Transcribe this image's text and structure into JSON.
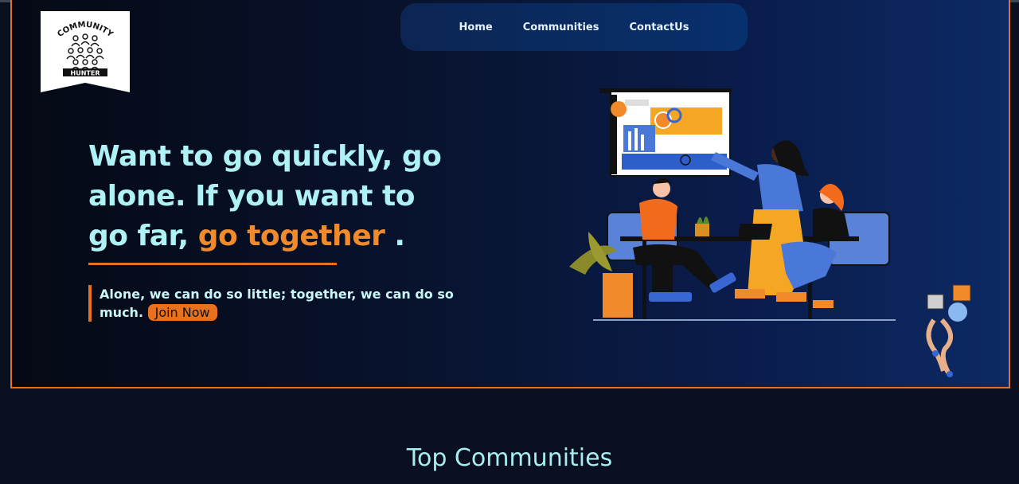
{
  "brand": {
    "logo_top": "COMMUNITY",
    "logo_bottom": "HUNTER"
  },
  "nav": {
    "items": [
      "Home",
      "Communities",
      "ContactUs"
    ]
  },
  "hero": {
    "headline_part1": "Want to go quickly, go alone. If you want to go far,",
    "headline_accent": "go together",
    "headline_end": ".",
    "quote": "Alone, we can do so little; together, we can do so much.",
    "cta_label": "Join Now"
  },
  "section": {
    "title": "Top Communities"
  },
  "colors": {
    "accent": "#e8711d",
    "headline": "#aef2f5",
    "background": "#0a1020",
    "nav_bg": "#0c2552"
  }
}
